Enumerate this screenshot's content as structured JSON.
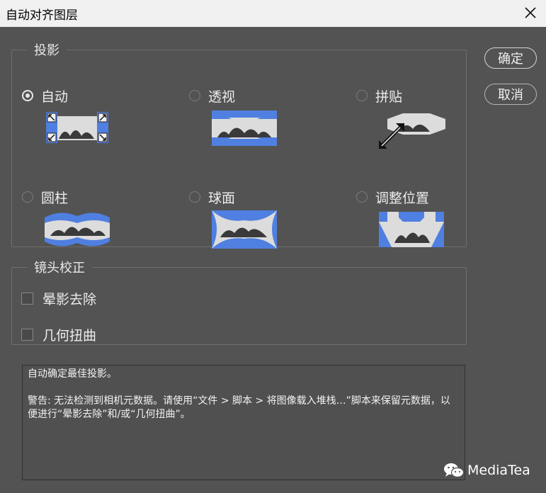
{
  "window": {
    "title": "自动对齐图层"
  },
  "projection": {
    "legend": "投影",
    "options": [
      {
        "label": "自动",
        "selected": true
      },
      {
        "label": "透视",
        "selected": false
      },
      {
        "label": "拼贴",
        "selected": false
      },
      {
        "label": "圆柱",
        "selected": false
      },
      {
        "label": "球面",
        "selected": false
      },
      {
        "label": "调整位置",
        "selected": false
      }
    ]
  },
  "lens": {
    "legend": "镜头校正",
    "options": [
      {
        "label": "晕影去除",
        "checked": false
      },
      {
        "label": "几何扭曲",
        "checked": false
      }
    ]
  },
  "buttons": {
    "ok": "确定",
    "cancel": "取消"
  },
  "info": {
    "line1": "自动确定最佳投影。",
    "line2": "警告: 无法检测到相机元数据。请使用“文件 > 脚本 > 将图像载入堆栈…”脚本来保留元数据，以便进行“晕影去除”和/或“几何扭曲”。"
  },
  "watermark": "MediaTea",
  "colors": {
    "panel": "#535353",
    "accent": "#3f78e0",
    "preview_light": "#dcdcdc"
  },
  "icons": [
    "close-icon",
    "auto-projection-icon",
    "perspective-projection-icon",
    "collage-projection-icon",
    "cylindrical-projection-icon",
    "spherical-projection-icon",
    "reposition-projection-icon",
    "wechat-icon"
  ]
}
